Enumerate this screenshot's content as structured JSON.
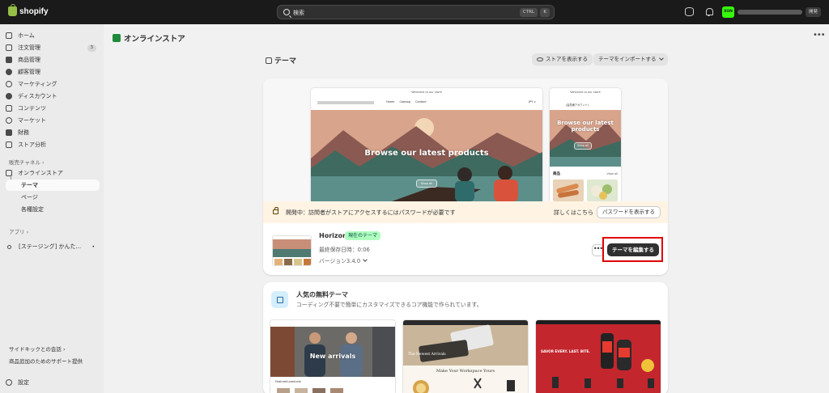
{
  "topbar": {
    "logo_text": "shopify",
    "search_placeholder": "検索",
    "shortcut_ctrl": "CTRL",
    "shortcut_k": "K",
    "avatar_text": "XON",
    "dev_badge": "開発"
  },
  "sidebar": {
    "items": [
      {
        "label": "ホーム",
        "icon": "home-icon"
      },
      {
        "label": "注文管理",
        "icon": "order-icon",
        "count": "3"
      },
      {
        "label": "商品管理",
        "icon": "tag-icon"
      },
      {
        "label": "顧客管理",
        "icon": "person-icon"
      },
      {
        "label": "マーケティング",
        "icon": "target-icon"
      },
      {
        "label": "ディスカウント",
        "icon": "discount-icon"
      },
      {
        "label": "コンテンツ",
        "icon": "content-icon"
      },
      {
        "label": "マーケット",
        "icon": "globe-icon"
      },
      {
        "label": "財務",
        "icon": "bank-icon"
      },
      {
        "label": "ストア分析",
        "icon": "chart-icon"
      }
    ],
    "channels_label": "販売チャネル ›",
    "online_store": "オンラインストア",
    "themes": "テーマ",
    "pages": "ページ",
    "preferences": "各種設定",
    "apps_label": "アプリ ›",
    "app_item": "[ステージング] かんた...",
    "sidekick": "サイドキックとの会話 ›",
    "support": "商品追加のためのサポート提供",
    "settings": "設定"
  },
  "header": {
    "title": "オンラインストア",
    "more": "•••"
  },
  "themes_section": {
    "title": "テーマ",
    "view_store": "ストアを表示する",
    "import_theme": "テーマをインポートする"
  },
  "preview": {
    "welcome": "Welcome to our store",
    "nav_links": [
      "Home",
      "Catalog",
      "Contact"
    ],
    "currency": "JPY ∨",
    "hero_desktop": "Browse our latest products",
    "hero_mobile": "Browse our latest products",
    "shop_all": "Shop all",
    "mobile_account": "(会員様アカウント)",
    "products_label": "商品",
    "view_all": "View all"
  },
  "banner": {
    "text": "開発中：訪問者がストアにアクセスするにはパスワードが必要です",
    "learn_more": "詳しくはこちら",
    "show_password": "パスワードを表示する"
  },
  "current_theme": {
    "name": "Horizon",
    "badge": "現在のテーマ",
    "saved": "最終保存日時：0:06",
    "version": "バージョン3.4.0",
    "edit": "テーマを編集する",
    "more": "•••"
  },
  "free_themes": {
    "title": "人気の無料テーマ",
    "subtitle": "コーディング不要で簡単にカスタマイズできるコア機能で作られています。",
    "cards": [
      {
        "text": "New arrivals",
        "sub": "Featured products"
      },
      {
        "text": "Make Your Workspace Yours",
        "sub": "The Newest Arrivals"
      },
      {
        "text": "SAVOR EVERY. LAST. BITE."
      }
    ]
  },
  "colors": {
    "topbar": "#1a1a1a",
    "avatar": "#36fc0a",
    "badge": "#affebf",
    "banner": "#fff4e4",
    "highlight": "#e00000"
  }
}
